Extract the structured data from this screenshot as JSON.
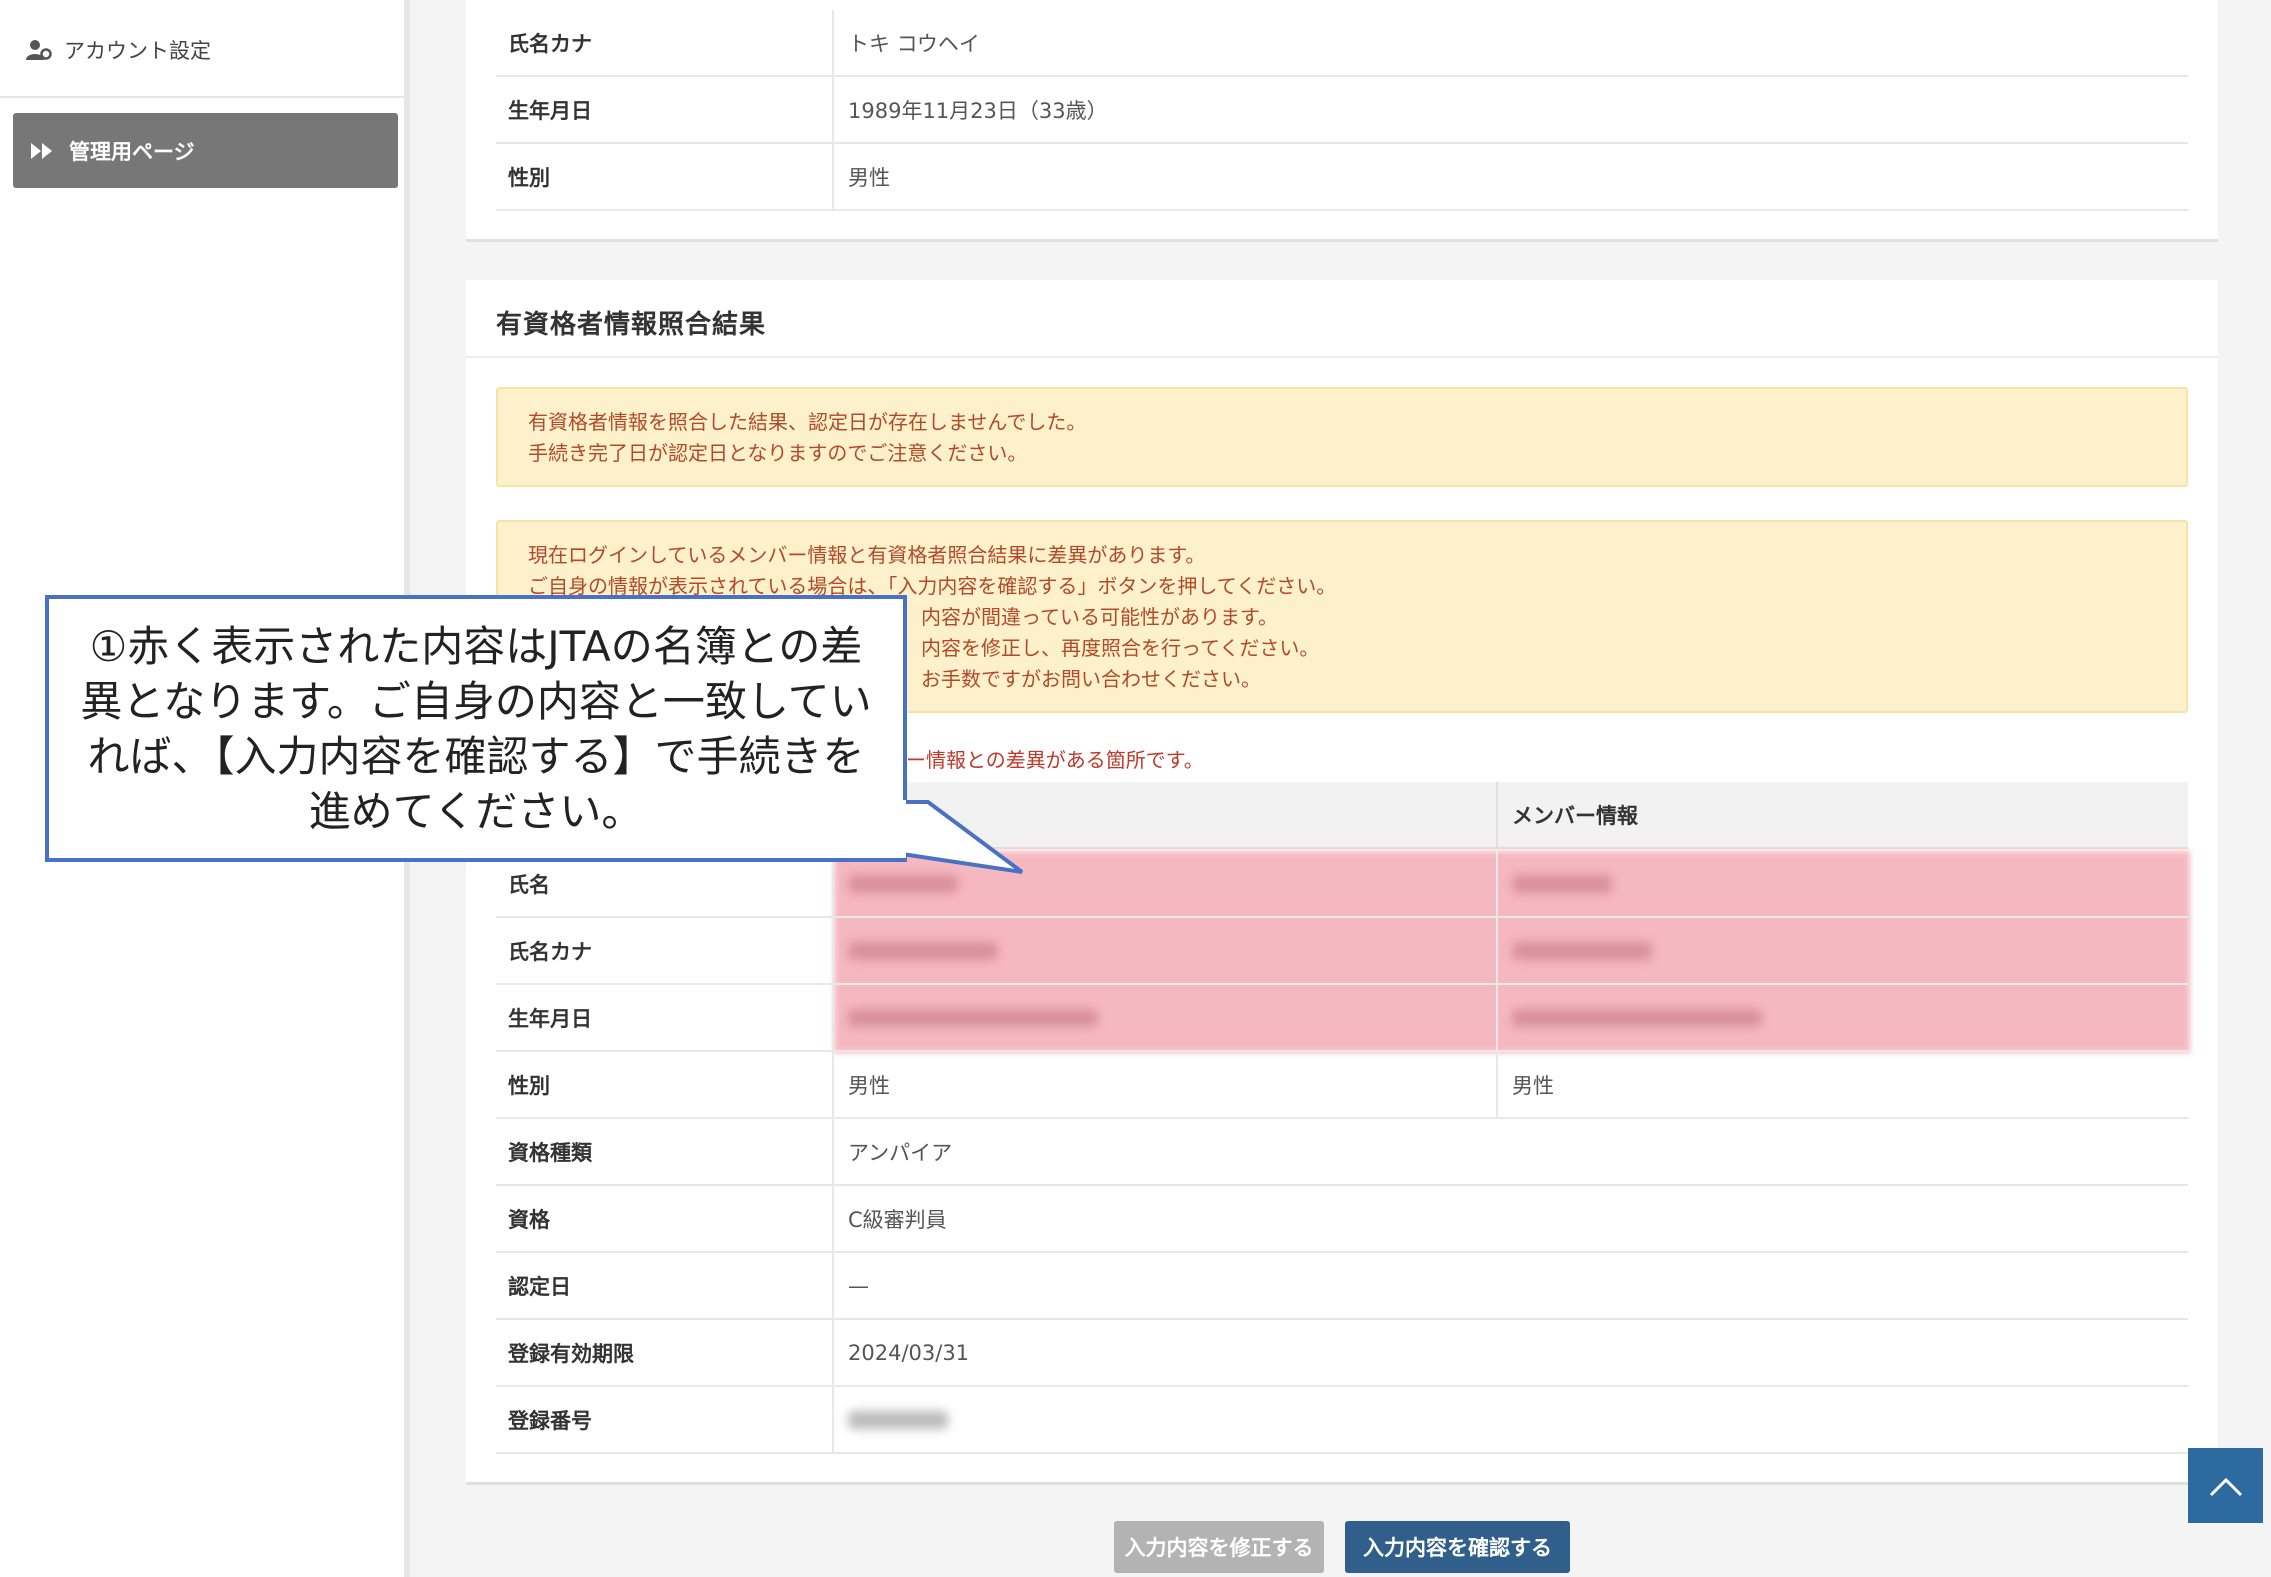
{
  "sidebar": {
    "account_label": "アカウント設定",
    "admin_label": "管理用ページ"
  },
  "member_info": {
    "rows": [
      {
        "label": "氏名カナ",
        "value": "トキ コウヘイ"
      },
      {
        "label": "生年月日",
        "value": "1989年11月23日（33歳）"
      },
      {
        "label": "性別",
        "value": "男性"
      }
    ]
  },
  "result": {
    "title": "有資格者情報照合結果",
    "alert1": [
      "有資格者情報を照合した結果、認定日が存在しませんでした。",
      "手続き完了日が認定日となりますのでご注意ください。"
    ],
    "alert2": [
      "現在ログインしているメンバー情報と有資格者照合結果に差異があります。",
      "ご自身の情報が表示されている場合は、「入力内容を確認する」ボタンを押してください。",
      "内容が間違っている可能性があります。",
      "内容を修正し、再度照合を行ってください。",
      "お手数ですがお問い合わせください。"
    ],
    "diff_note": "ー情報との差異がある箇所です。",
    "col_member": "メンバー情報",
    "compare_rows": [
      {
        "label": "氏名"
      },
      {
        "label": "氏名カナ"
      },
      {
        "label": "生年月日"
      },
      {
        "label": "性別",
        "qual": "男性",
        "member": "男性"
      }
    ],
    "single_rows": [
      {
        "label": "資格種類",
        "value": "アンパイア"
      },
      {
        "label": "資格",
        "value": "C級審判員"
      },
      {
        "label": "認定日",
        "value": "—"
      },
      {
        "label": "登録有効期限",
        "value": "2024/03/31"
      },
      {
        "label": "登録番号",
        "value": ""
      }
    ]
  },
  "annotation": {
    "text": "①赤く表示された内容はJTAの名簿との差異となります。ご自身の内容と一致していれば、【入力内容を確認する】で手続きを進めてください。"
  },
  "buttons": {
    "edit_label": "入力内容を修正する",
    "confirm_label": "入力内容を確認する"
  },
  "colors": {
    "accent": "#2f5f8a",
    "alert_bg": "#fdf1cc",
    "alert_text": "#b24a2a",
    "diff_highlight": "#f6b8c0",
    "callout_border": "#4a72c4"
  }
}
